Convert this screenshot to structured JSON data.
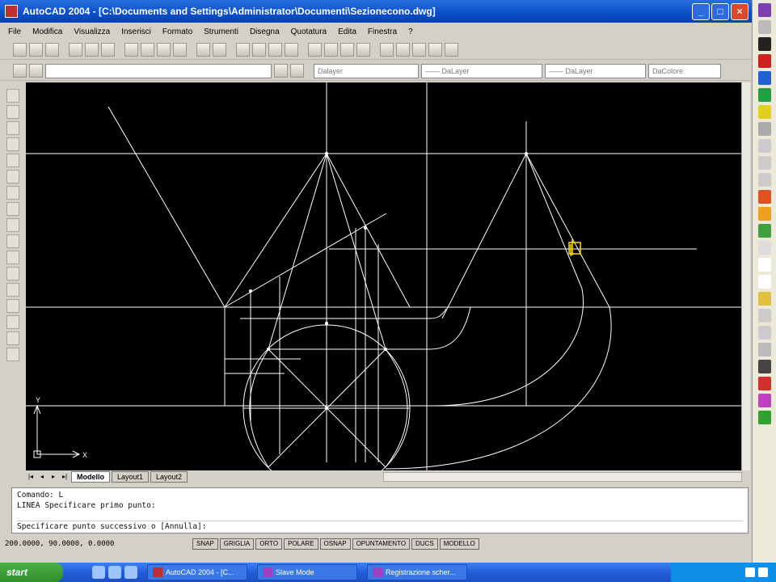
{
  "window": {
    "title": "AutoCAD 2004 - [C:\\Documents and Settings\\Administrator\\Documenti\\Sezionecono.dwg]",
    "min": "_",
    "max": "□",
    "close": "×"
  },
  "menu": [
    "File",
    "Modifica",
    "Visualizza",
    "Inserisci",
    "Formato",
    "Strumenti",
    "Disegna",
    "Quotatura",
    "Edita",
    "Finestra",
    "?"
  ],
  "toolbar2": {
    "layer_combo": "",
    "color_combo": "Dalayer",
    "ltype_combo": "—— DaLayer",
    "lweight_combo": "—— DaLayer",
    "plotstyle_combo": "DaColore"
  },
  "tabs": [
    "Modello",
    "Layout1",
    "Layout2"
  ],
  "command_lines": [
    "Comando:  L",
    "LINEA Specificare primo punto:",
    "Specificare punto successivo o [Annulla]:"
  ],
  "status": {
    "coords": "200.0000, 90.0000, 0.0000",
    "buttons": [
      "SNAP",
      "GRIGLIA",
      "ORTO",
      "POLARE",
      "OSNAP",
      "OPUNTAMENTO",
      "DUCS",
      "MODELLO"
    ]
  },
  "ucs": {
    "x": "X",
    "y": "Y"
  },
  "taskbar": {
    "start": "start",
    "tasks": [
      "AutoCAD 2004 - [C...",
      "Slave Mode",
      "Registrazione scher..."
    ],
    "clock": ""
  },
  "colors": {
    "canvas": "#000000",
    "drawing": "#ffffff",
    "cursor": "#ffe000",
    "titlebar": "#0a4fc8"
  }
}
